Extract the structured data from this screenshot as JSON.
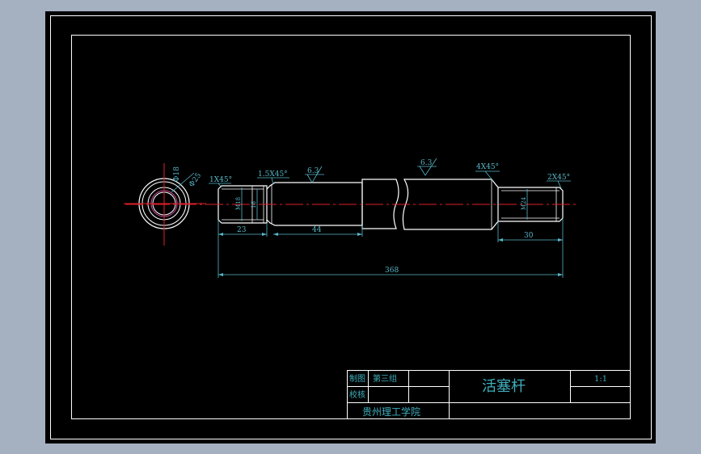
{
  "colors": {
    "background": "#a5b0c1",
    "sheet": "#000000",
    "frame": "#ffffff",
    "object_line": "#ffffff",
    "center_line": "#e0202a",
    "dimension": "#58b7c7",
    "title_text": "#3fb0bd",
    "thread_circle": "#d64aa0"
  },
  "annotations": {
    "end_view_dia_small": "Φ18",
    "end_view_dia_large": "Φ25",
    "chamfer_left": "1X45°",
    "chamfer_step": "1.5X45°",
    "roughness_left": "6.3",
    "roughness_right": "6.3",
    "chamfer_mid": "4X45°",
    "chamfer_right": "2X45°",
    "dia_left_outer": "M18",
    "dia_left_inner": "16",
    "dia_right": "M24"
  },
  "dimensions": {
    "len_left_thread": "23",
    "len_left_section": "44",
    "len_right_thread": "30",
    "total_length": "368"
  },
  "title_block": {
    "drawn_label": "制图",
    "checked_label": "校核",
    "group": "第三组",
    "part_name": "活塞杆",
    "scale": "1:1",
    "school": "贵州理工学院"
  }
}
